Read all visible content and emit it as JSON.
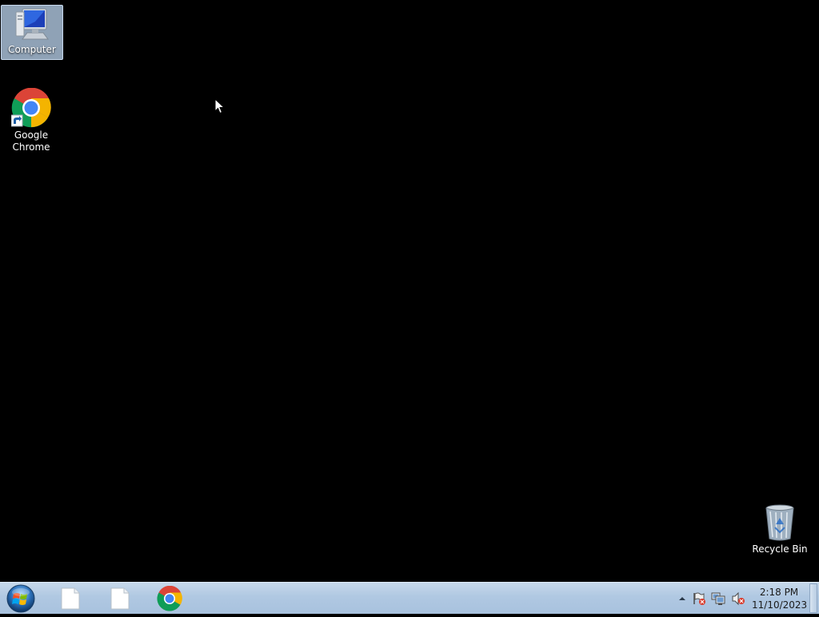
{
  "desktop": {
    "icons": [
      {
        "label": "Computer",
        "icon": "computer-icon",
        "selected": true
      },
      {
        "label": "Google Chrome",
        "icon": "chrome-shortcut-icon",
        "selected": false
      },
      {
        "label": "Recycle Bin",
        "icon": "recycle-bin-icon",
        "selected": false
      }
    ]
  },
  "taskbar": {
    "start_icon": "windows-start-orb-icon",
    "pinned": [
      {
        "icon": "blank-document-icon"
      },
      {
        "icon": "blank-document-icon"
      },
      {
        "icon": "chrome-icon"
      }
    ],
    "tray": {
      "icons": [
        "show-hidden-icons-arrow",
        "action-center-flag-icon",
        "network-icon",
        "volume-muted-icon"
      ],
      "time": "2:18 PM",
      "date": "11/10/2023"
    }
  },
  "colors": {
    "desktop_background": "#000000",
    "taskbar": "#b0c8e2",
    "selection": "#a8bed6"
  }
}
